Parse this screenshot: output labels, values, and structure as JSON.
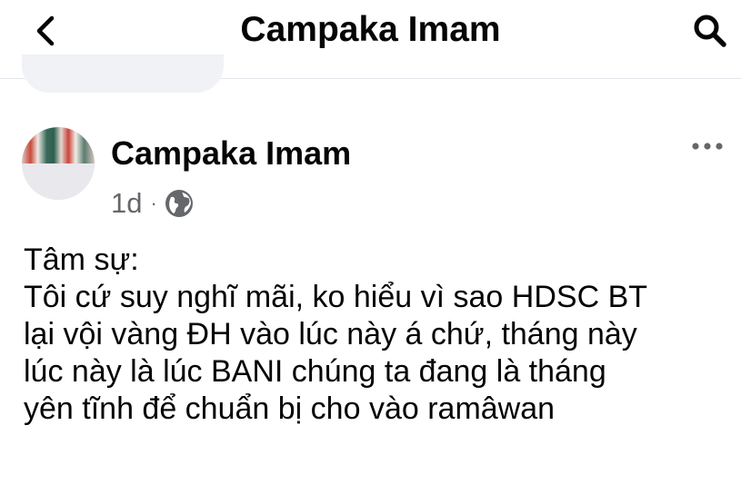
{
  "header": {
    "back_icon": "chevron-left-icon",
    "title": "Campaka Imam",
    "search_icon": "search-icon"
  },
  "post": {
    "author_name": "Campaka Imam",
    "timestamp": "1d",
    "separator": "·",
    "privacy_icon": "globe-icon",
    "more_icon": "more-horizontal-icon",
    "text": "Tâm sự:\nTôi cứ suy nghĩ mãi, ko hiểu vì sao HDSC  BT\nlại vội vàng ĐH vào lúc này á chứ, tháng này\nlúc này là lúc BANI chúng ta đang là tháng\nyên tĩnh để chuẩn bị cho vào ramâwan"
  },
  "colors": {
    "text_primary": "#050505",
    "text_secondary": "#65676b",
    "divider": "#e4e6eb"
  }
}
